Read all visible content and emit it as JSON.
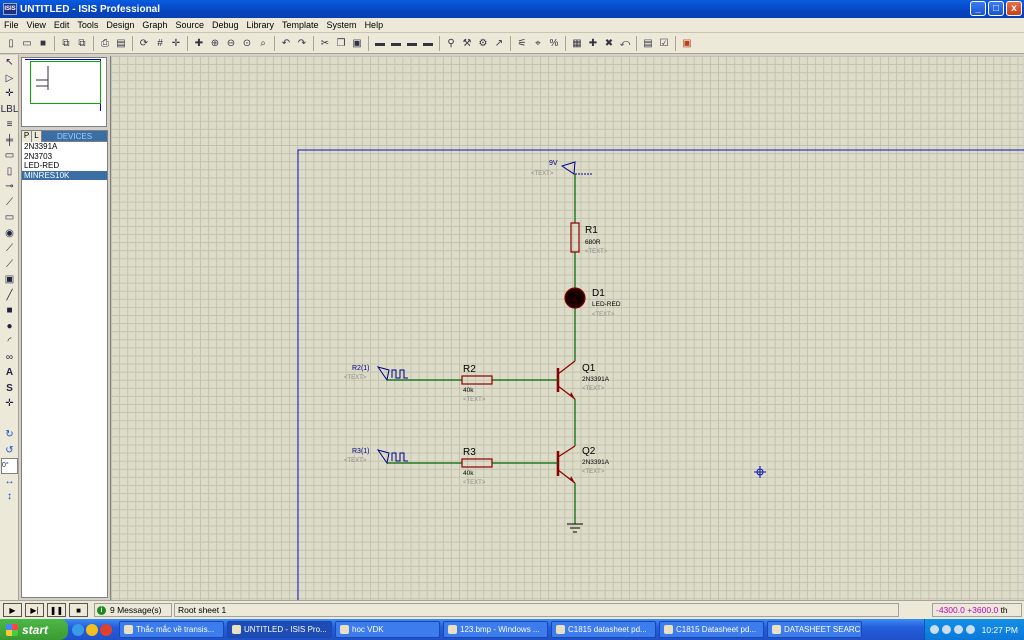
{
  "window": {
    "app_icon_text": "ISIS",
    "title": "UNTITLED - ISIS Professional",
    "minimize": "_",
    "maximize": "□",
    "close": "x"
  },
  "menu": [
    "File",
    "View",
    "Edit",
    "Tools",
    "Design",
    "Graph",
    "Source",
    "Debug",
    "Library",
    "Template",
    "System",
    "Help"
  ],
  "devices": {
    "tab_p": "P",
    "tab_l": "L",
    "title": "DEVICES",
    "items": [
      "2N3391A",
      "2N3703",
      "LED-RED",
      "MINRES10K"
    ],
    "selected_index": 3
  },
  "schematic": {
    "power": {
      "label": "9V",
      "text": "<TEXT>"
    },
    "r1": {
      "ref": "R1",
      "value": "680R",
      "text": "<TEXT>"
    },
    "d1": {
      "ref": "D1",
      "value": "LED-RED",
      "text": "<TEXT>"
    },
    "q1": {
      "ref": "Q1",
      "value": "2N3391A",
      "text": "<TEXT>"
    },
    "q2": {
      "ref": "Q2",
      "value": "2N3391A",
      "text": "<TEXT>"
    },
    "r2": {
      "ref": "R2",
      "value": "40k",
      "text": "<TEXT>"
    },
    "r3": {
      "ref": "R3",
      "value": "40k",
      "text": "<TEXT>"
    },
    "gen1": {
      "label": "R2(1)",
      "text": "<TEXT>"
    },
    "gen2": {
      "label": "R3(1)",
      "text": "<TEXT>"
    }
  },
  "status": {
    "messages": "9 Message(s)",
    "sheet": "Root sheet 1",
    "coord_x": "-4300.0",
    "coord_y": "+3600.0",
    "coord_unit": "th"
  },
  "taskbar": {
    "start": "start",
    "tasks": [
      {
        "label": "Thắc mắc về transis...",
        "active": false
      },
      {
        "label": "UNTITLED - ISIS Pro...",
        "active": true
      },
      {
        "label": "hoc VDK",
        "active": false
      },
      {
        "label": "123.bmp - Windows ...",
        "active": false
      },
      {
        "label": "C1815 datasheet pd...",
        "active": false
      },
      {
        "label": "C1815 Datasheet pd...",
        "active": false
      },
      {
        "label": "DATASHEET SEARCH...",
        "active": false
      }
    ],
    "clock": "10:27 PM"
  },
  "colors": {
    "wire": "#006400",
    "component": "#8b0000",
    "label_blue": "#00008b",
    "sheet_border": "#0000c0"
  }
}
